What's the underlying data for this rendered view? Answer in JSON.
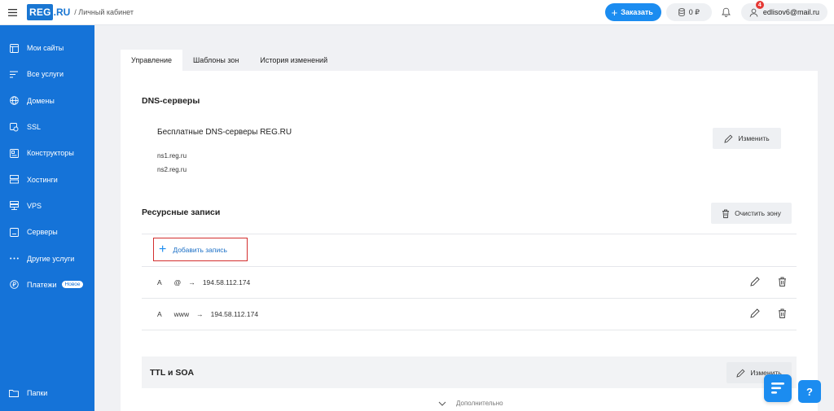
{
  "header": {
    "logo_text": "REG",
    "logo_suffix": ".RU",
    "cabinet_label": "/ Личный кабинет",
    "order_label": "Заказать",
    "balance": "0 ₽",
    "notification_count": "4",
    "user_email": "edlisov6@mail.ru"
  },
  "sidebar": {
    "items": [
      {
        "label": "Мои сайты",
        "icon": "sites-icon"
      },
      {
        "label": "Все услуги",
        "icon": "list-icon"
      },
      {
        "label": "Домены",
        "icon": "globe-icon"
      },
      {
        "label": "SSL",
        "icon": "ssl-lock-icon"
      },
      {
        "label": "Конструкторы",
        "icon": "builder-icon"
      },
      {
        "label": "Хостинги",
        "icon": "hosting-icon"
      },
      {
        "label": "VPS",
        "icon": "vps-icon"
      },
      {
        "label": "Серверы",
        "icon": "server-icon"
      },
      {
        "label": "Другие услуги",
        "icon": "more-dots-icon"
      },
      {
        "label": "Платежи",
        "icon": "payment-icon",
        "badge": "Новое"
      }
    ],
    "bottom_item": {
      "label": "Папки",
      "icon": "folder-icon"
    }
  },
  "tabs": [
    {
      "label": "Управление",
      "active": true
    },
    {
      "label": "Шаблоны зон",
      "active": false
    },
    {
      "label": "История изменений",
      "active": false
    }
  ],
  "dns_section": {
    "title": "DNS-серверы",
    "provider_name": "Бесплатные DNS-серверы REG.RU",
    "ns1": "ns1.reg.ru",
    "ns2": "ns2.reg.ru",
    "edit_label": "Изменить"
  },
  "records_section": {
    "title": "Ресурсные записи",
    "clear_label": "Очистить зону",
    "add_label": "Добавить запись",
    "records": [
      {
        "type": "A",
        "name": "@",
        "arrow": "→",
        "value": "194.58.112.174"
      },
      {
        "type": "A",
        "name": "www",
        "arrow": "→",
        "value": "194.58.112.174"
      }
    ]
  },
  "ttl_section": {
    "title": "TTL и SOA",
    "edit_label": "Изменить",
    "more_label": "Дополнительно"
  },
  "help_label": "?",
  "colors": {
    "sidebar": "#1573d8",
    "accent": "#1b8cf0",
    "highlight": "#d32f2f"
  }
}
